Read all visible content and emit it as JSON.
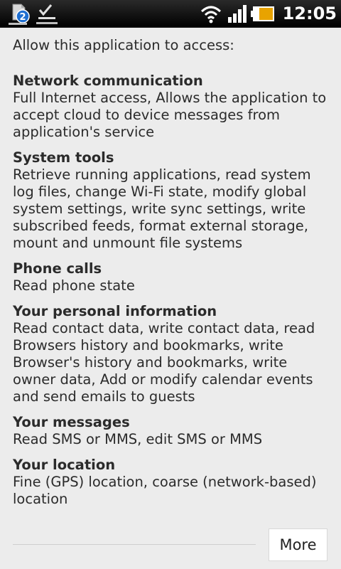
{
  "status_bar": {
    "notification_count": "2",
    "time": "12:05",
    "icons": [
      "file-notification-icon",
      "download-complete-icon",
      "wifi-icon",
      "signal-icon",
      "battery-charging-icon"
    ],
    "battery_color": "#e8a300"
  },
  "permissions": {
    "intro": "Allow this application to access:",
    "groups": [
      {
        "title": "Network communication",
        "description": "Full Internet access, Allows the application to accept cloud to device messages from application's service"
      },
      {
        "title": "System tools",
        "description": "Retrieve running applications, read system log files, change Wi-Fi state, modify global system settings, write sync settings, write subscribed feeds, format external storage, mount and unmount file systems"
      },
      {
        "title": "Phone calls",
        "description": "Read phone state"
      },
      {
        "title": "Your personal information",
        "description": "Read contact data, write contact data, read Browsers history and bookmarks, write Browser's history and bookmarks, write owner data, Add or modify calendar events and send emails to guests"
      },
      {
        "title": "Your messages",
        "description": "Read SMS or MMS, edit SMS or MMS"
      },
      {
        "title": "Your location",
        "description": "Fine (GPS) location, coarse (network-based) location"
      }
    ],
    "more_label": "More"
  }
}
